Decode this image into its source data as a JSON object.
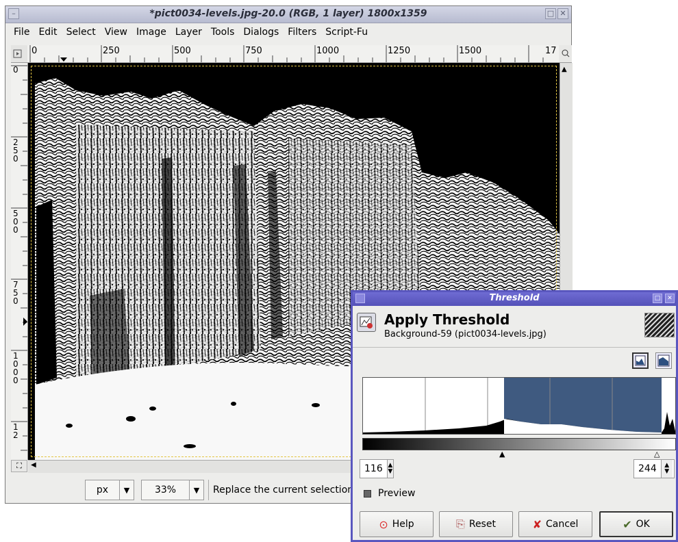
{
  "window": {
    "title": "*pict0034-levels.jpg-20.0 (RGB, 1 layer) 1800x1359",
    "menu": [
      "File",
      "Edit",
      "Select",
      "View",
      "Image",
      "Layer",
      "Tools",
      "Dialogs",
      "Filters",
      "Script-Fu"
    ],
    "ruler_top_labels": [
      "0",
      "250",
      "500",
      "750",
      "1000",
      "1250",
      "1500",
      "17"
    ],
    "ruler_left_labels": [
      "0",
      "250",
      "500",
      "750",
      "1000",
      "12"
    ],
    "unit": "px",
    "zoom": "33%",
    "status": "Replace the current selection"
  },
  "dialog": {
    "title": "Threshold",
    "heading": "Apply Threshold",
    "subheading": "Background-59 (pict0034-levels.jpg)",
    "low_value": "116",
    "high_value": "244",
    "preview_label": "Preview",
    "buttons": {
      "help": "Help",
      "reset": "Reset",
      "cancel": "Cancel",
      "ok": "OK"
    }
  },
  "colors": {
    "dialog_border": "#5a57bf",
    "histogram_selection": "#3f5a80",
    "selection_marquee": "#e2c441"
  }
}
